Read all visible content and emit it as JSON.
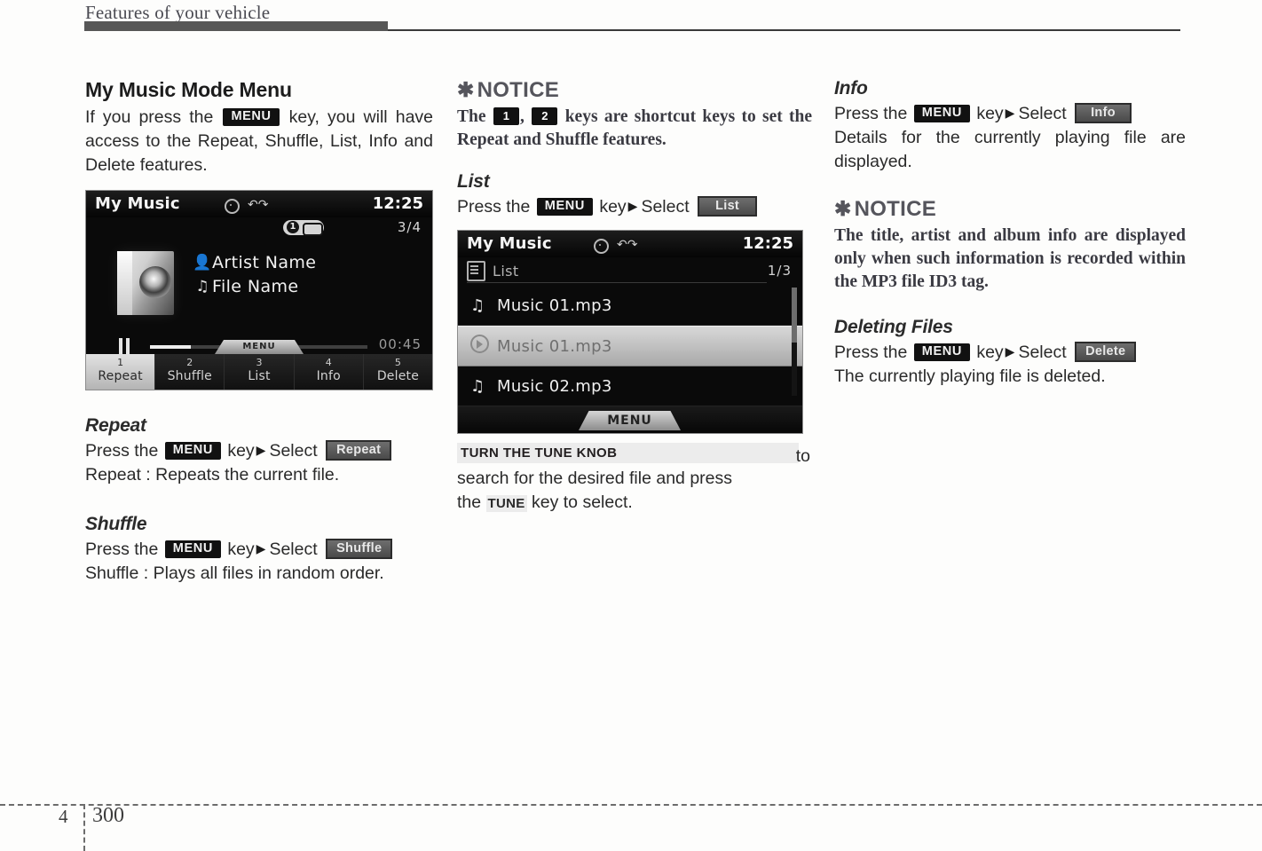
{
  "header": {
    "title": "Features of your vehicle"
  },
  "footer": {
    "chapter": "4",
    "page": "300"
  },
  "col1": {
    "heading": "My Music Mode Menu",
    "intro_pre": "If you press the",
    "menu_chip": "MENU",
    "intro_post": "key, you will have access to the Repeat, Shuffle, List, Info and Delete features.",
    "player": {
      "title": "My Music",
      "clock": "12:25",
      "counter": "3/4",
      "repeat_badge": "1",
      "artist": "Artist Name",
      "file": "File Name",
      "elapsed": "00:45",
      "menu_tab": "MENU",
      "tabs": [
        {
          "num": "1",
          "label": "Repeat",
          "active": true
        },
        {
          "num": "2",
          "label": "Shuffle",
          "active": false
        },
        {
          "num": "3",
          "label": "List",
          "active": false
        },
        {
          "num": "4",
          "label": "Info",
          "active": false
        },
        {
          "num": "5",
          "label": "Delete",
          "active": false
        }
      ]
    },
    "repeat": {
      "heading": "Repeat",
      "press": "Press the",
      "chip": "MENU",
      "key_select": "key",
      "select": "Select",
      "soft": "Repeat",
      "desc": "Repeat : Repeats the current file."
    },
    "shuffle": {
      "heading": "Shuffle",
      "press": "Press the",
      "chip": "MENU",
      "key_select": "key",
      "select": "Select",
      "soft": "Shuffle",
      "desc": "Shuffle : Plays all files in random order."
    }
  },
  "col2": {
    "notice": {
      "star": "✱",
      "heading": "NOTICE",
      "pre": "The",
      "key1": "1",
      "mid": ",",
      "key2": "2",
      "post": "keys are shortcut keys to set the Repeat and Shuffle features."
    },
    "list": {
      "heading": "List",
      "press": "Press the",
      "chip": "MENU",
      "key_select": "key",
      "select": "Select",
      "soft": "List"
    },
    "list_device": {
      "title": "My Music",
      "clock": "12:25",
      "sub_label": "List",
      "count": "1/3",
      "menu_tab": "MENU",
      "rows": [
        {
          "label": "Music 01.mp3",
          "icon": "music-note-icon",
          "selected": false
        },
        {
          "label": "Music 01.mp3",
          "icon": "play-circle-icon",
          "selected": true
        },
        {
          "label": "Music 02.mp3",
          "icon": "music-note-icon",
          "selected": false
        }
      ]
    },
    "knob": {
      "highlight": "TURN THE TUNE KNOB",
      "to": "to",
      "line2": "search for the desired file and press",
      "line3_pre": "the",
      "tune_chip": "TUNE",
      "line3_post": "key to select."
    }
  },
  "col3": {
    "info": {
      "heading": "Info",
      "press": "Press the",
      "chip": "MENU",
      "key_select": "key",
      "select": "Select",
      "soft": "Info",
      "desc": "Details for the currently playing file are displayed."
    },
    "notice": {
      "star": "✱",
      "heading": "NOTICE",
      "body": "The title, artist and album info are displayed only when such information is recorded within the MP3 file ID3 tag."
    },
    "delete": {
      "heading": "Deleting Files",
      "press": "Press the",
      "chip": "MENU",
      "key_select": "key",
      "select": "Select",
      "soft": "Delete",
      "desc": "The currently playing file is deleted."
    }
  }
}
